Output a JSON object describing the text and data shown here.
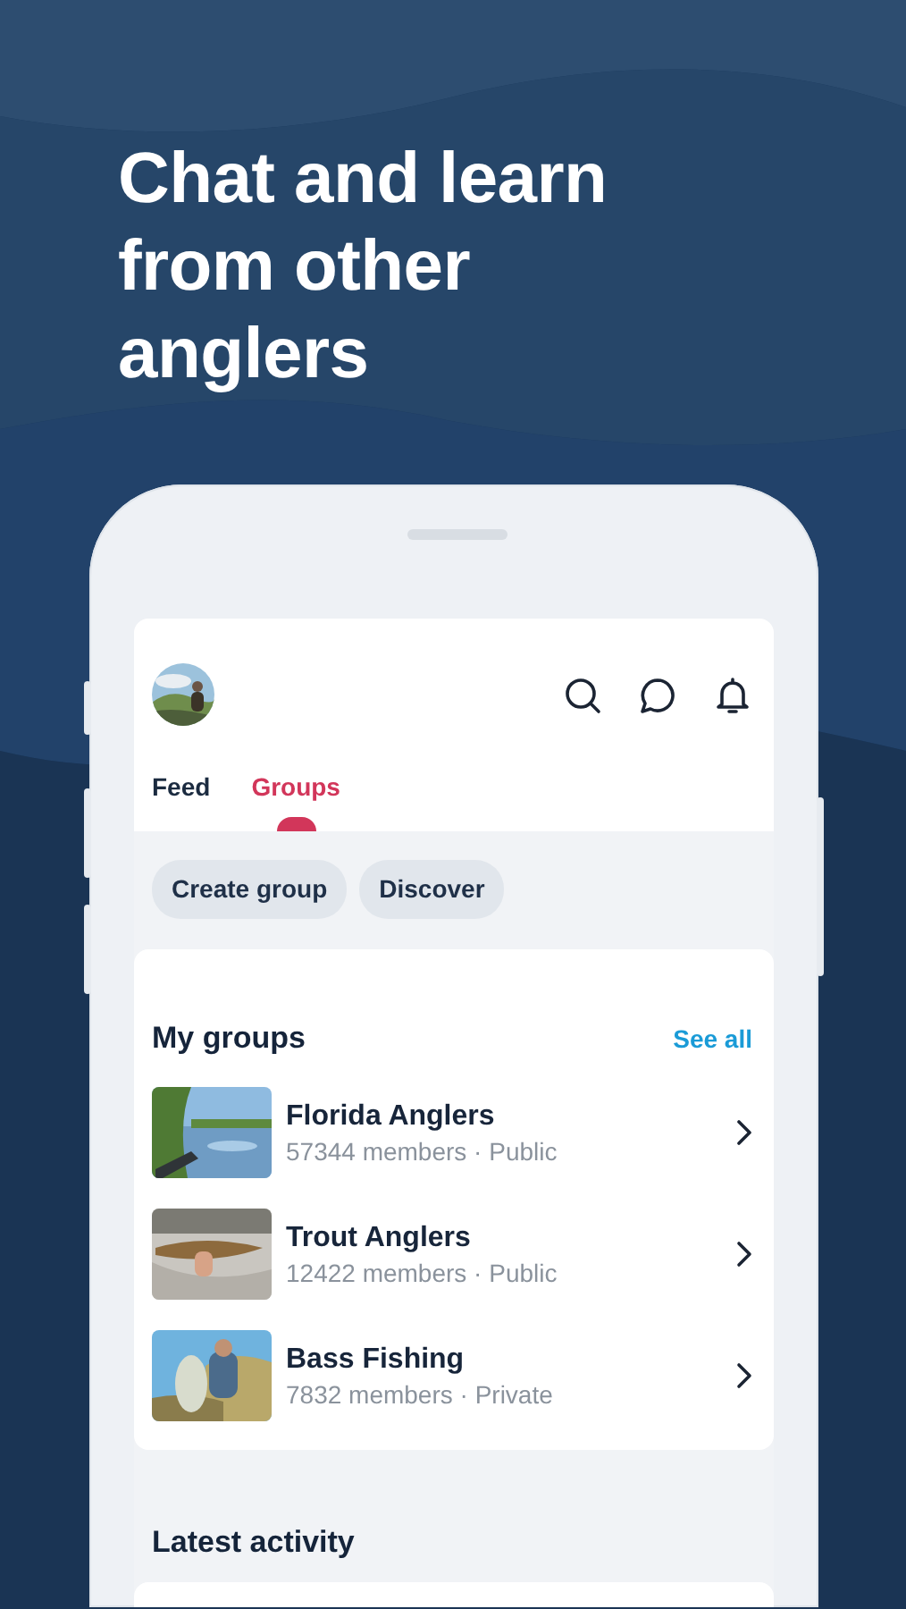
{
  "headline": "Chat and learn from other anglers",
  "tabs": [
    {
      "label": "Feed",
      "selected": false
    },
    {
      "label": "Groups",
      "selected": true
    }
  ],
  "chips": [
    "Create group",
    "Discover"
  ],
  "my_groups": {
    "title": "My groups",
    "see_all": "See all",
    "items": [
      {
        "name": "Florida Anglers",
        "meta": "57344 members · Public",
        "kind": "picture"
      },
      {
        "name": "Trout Anglers",
        "meta": "12422 members · Public",
        "kind": "picture"
      },
      {
        "name": "Bass Fishing",
        "meta": "7832 members · Private",
        "kind": "picture"
      }
    ]
  },
  "latest_activity": {
    "title": "Latest activity"
  }
}
